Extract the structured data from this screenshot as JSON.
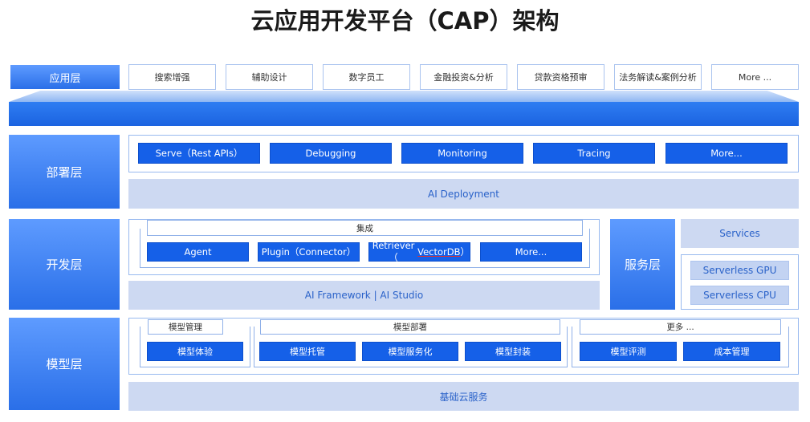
{
  "title": "云应用开发平台（CAP）架构",
  "app_layer": {
    "label": "应用层",
    "items": [
      "搜索增强",
      "辅助设计",
      "数字员工",
      "金融投资&分析",
      "贷款资格预审",
      "法务解读&案例分析",
      "More ..."
    ]
  },
  "deploy_layer": {
    "label": "部署层",
    "buttons": [
      "Serve（Rest APIs）",
      "Debugging",
      "Monitoring",
      "Tracing",
      "More..."
    ],
    "base": "AI Deployment"
  },
  "dev_layer": {
    "label": "开发层",
    "integration_title": "集成",
    "buttons": [
      "Agent",
      "Plugin（Connector）",
      "Retriever（",
      "VectorDB",
      "）",
      "More..."
    ],
    "base": "AI Framework | AI Studio"
  },
  "service_layer": {
    "label": "服务层",
    "services": "Services",
    "chips": [
      "Serverless GPU",
      "Serverless CPU"
    ]
  },
  "model_layer": {
    "label": "模型层",
    "groups": [
      {
        "title": "模型管理",
        "items": [
          "模型体验"
        ]
      },
      {
        "title": "模型部署",
        "items": [
          "模型托管",
          "模型服务化",
          "模型封装"
        ]
      },
      {
        "title": "更多 ...",
        "items": [
          "模型评测",
          "成本管理"
        ]
      }
    ],
    "base": "基础云服务"
  },
  "colors": {
    "primary_blue": "#1560e8",
    "label_gradient_top": "#5e9bff",
    "label_gradient_bottom": "#2a6fe8",
    "light_fill": "#cdd9f2",
    "border": "#98b9ef"
  }
}
